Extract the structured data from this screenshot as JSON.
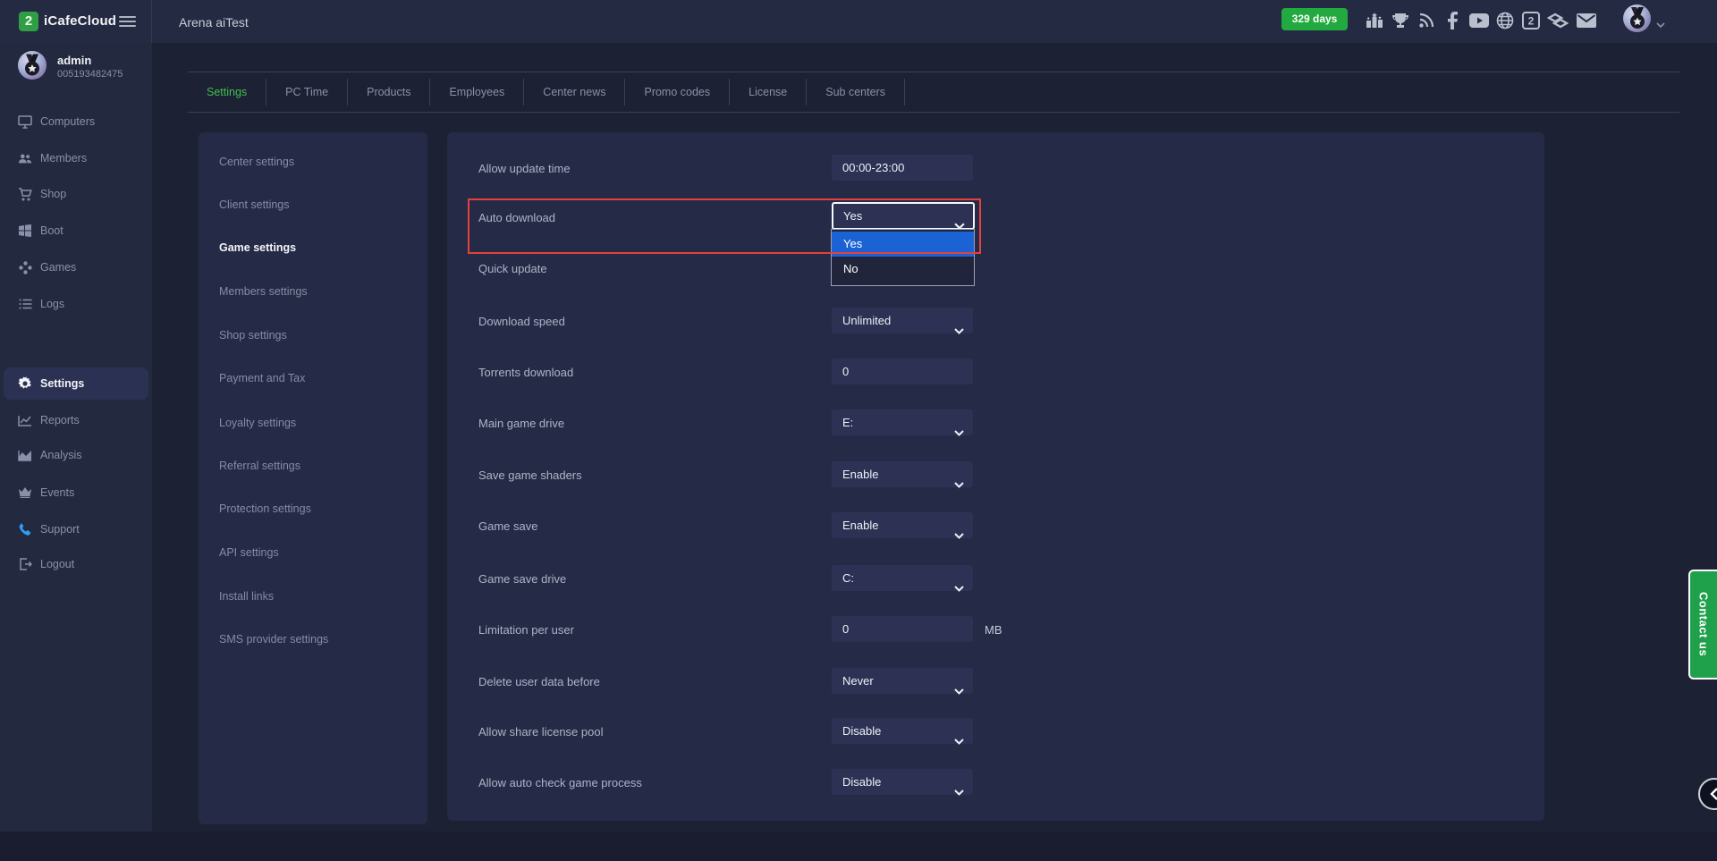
{
  "topbar": {
    "brand": "iCafeCloud",
    "logo_glyph": "2",
    "title": "Arena aiTest",
    "days_badge": "329 days",
    "icon_names": [
      "ranking-podium-icon",
      "trophy-icon",
      "rss-icon",
      "facebook-icon",
      "youtube-icon",
      "globe-icon",
      "icafecloud-icon",
      "layers-icon",
      "mail-icon",
      "avatar",
      "chevron-down-icon"
    ]
  },
  "user": {
    "name": "admin",
    "id": "005193482475"
  },
  "sidebar": {
    "items": [
      {
        "label": "Computers"
      },
      {
        "label": "Members"
      },
      {
        "label": "Shop"
      },
      {
        "label": "Boot"
      },
      {
        "label": "Games"
      },
      {
        "label": "Logs"
      },
      {
        "label": "Settings",
        "active": true
      },
      {
        "label": "Reports"
      },
      {
        "label": "Analysis"
      },
      {
        "label": "Events"
      },
      {
        "label": "Support"
      },
      {
        "label": "Logout"
      }
    ]
  },
  "tabs": {
    "items": [
      {
        "label": "Settings",
        "active": true
      },
      {
        "label": "PC Time"
      },
      {
        "label": "Products"
      },
      {
        "label": "Employees"
      },
      {
        "label": "Center news"
      },
      {
        "label": "Promo codes"
      },
      {
        "label": "License"
      },
      {
        "label": "Sub centers"
      }
    ]
  },
  "settings_nav": {
    "items": [
      {
        "label": "Center settings"
      },
      {
        "label": "Client settings"
      },
      {
        "label": "Game settings",
        "active": true
      },
      {
        "label": "Members settings"
      },
      {
        "label": "Shop settings"
      },
      {
        "label": "Payment and Tax"
      },
      {
        "label": "Loyalty settings"
      },
      {
        "label": "Referral settings"
      },
      {
        "label": "Protection settings"
      },
      {
        "label": "API settings"
      },
      {
        "label": "Install links"
      },
      {
        "label": "SMS provider settings"
      }
    ]
  },
  "form": {
    "rows": [
      {
        "label": "Allow update time",
        "type": "input",
        "value": "00:00-23:00"
      },
      {
        "label": "Auto download",
        "type": "select",
        "value": "Yes"
      },
      {
        "label": "Quick update",
        "type": "input",
        "value": ""
      },
      {
        "label": "Download speed",
        "type": "select",
        "value": "Unlimited"
      },
      {
        "label": "Torrents download",
        "type": "input",
        "value": "0"
      },
      {
        "label": "Main game drive",
        "type": "select",
        "value": "E:"
      },
      {
        "label": "Save game shaders",
        "type": "select",
        "value": "Enable"
      },
      {
        "label": "Game save",
        "type": "select",
        "value": "Enable"
      },
      {
        "label": "Game save drive",
        "type": "select",
        "value": "C:"
      },
      {
        "label": "Limitation per user",
        "type": "input",
        "value": "0",
        "unit": "MB"
      },
      {
        "label": "Delete user data before",
        "type": "select",
        "value": "Never"
      },
      {
        "label": "Allow share license pool",
        "type": "select",
        "value": "Disable"
      },
      {
        "label": "Allow auto check game process",
        "type": "select",
        "value": "Disable"
      }
    ]
  },
  "dropdown": {
    "options": [
      {
        "label": "Yes",
        "highlighted": true
      },
      {
        "label": "No",
        "highlighted": false
      }
    ]
  },
  "contact": {
    "label": "Contact us"
  },
  "colors": {
    "accent_green": "#22a93f",
    "tab_active_green": "#3fbf4f",
    "option_highlight_blue": "#1b62d4",
    "annotation_red": "#e6403a",
    "panel": "#252b47",
    "field": "#2d3254",
    "content_bg": "#1d2134",
    "bar_bg": "#242a41"
  }
}
